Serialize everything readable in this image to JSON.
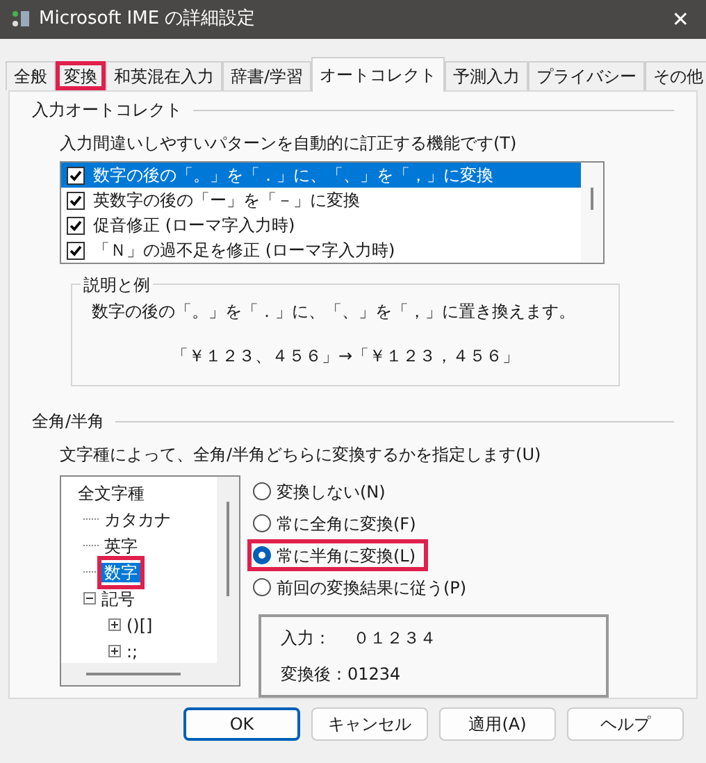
{
  "window": {
    "title": "Microsoft IME の詳細設定",
    "close": "✕"
  },
  "tabs": [
    {
      "label": "全般",
      "selected": false,
      "highlighted": false
    },
    {
      "label": "変換",
      "selected": false,
      "highlighted": true
    },
    {
      "label": "和英混在入力",
      "selected": false,
      "highlighted": false
    },
    {
      "label": "辞書/学習",
      "selected": false,
      "highlighted": false
    },
    {
      "label": "オートコレクト",
      "selected": true,
      "highlighted": false
    },
    {
      "label": "予測入力",
      "selected": false,
      "highlighted": false
    },
    {
      "label": "プライバシー",
      "selected": false,
      "highlighted": false
    },
    {
      "label": "その他",
      "selected": false,
      "highlighted": false
    }
  ],
  "autocorrect": {
    "title": "入力オートコレクト",
    "label": "入力間違いしやすいパターンを自動的に訂正する機能です(T)",
    "items": [
      {
        "label": "数字の後の「。」を「．」に、「、」を「，」に変換",
        "checked": true,
        "selected": true
      },
      {
        "label": "英数字の後の「ー」を「－」に変換",
        "checked": true,
        "selected": false
      },
      {
        "label": "促音修正 (ローマ字入力時)",
        "checked": true,
        "selected": false
      },
      {
        "label": "「Ｎ」の過不足を修正 (ローマ字入力時)",
        "checked": true,
        "selected": false
      }
    ],
    "example": {
      "title": "説明と例",
      "description": "数字の後の「。」を「．」に、「、」を「，」に置き換えます。",
      "sample": "「￥１２３、４５６」→「￥１２３，４５６」"
    }
  },
  "width": {
    "title": "全角/半角",
    "label": "文字種によって、全角/半角どちらに変換するかを指定します(U)",
    "tree": [
      {
        "label": "全文字種",
        "selected": false,
        "highlighted": false,
        "children": [
          {
            "label": "カタカナ",
            "selected": false,
            "highlighted": false
          },
          {
            "label": "英字",
            "selected": false,
            "highlighted": false
          },
          {
            "label": "数字",
            "selected": true,
            "highlighted": true
          },
          {
            "label": "記号",
            "selected": false,
            "highlighted": false,
            "expanded": true,
            "children": [
              {
                "label": "()[]",
                "selected": false,
                "highlighted": false,
                "expanded": false
              },
              {
                "label": ":;",
                "selected": false,
                "highlighted": false,
                "expanded": false
              }
            ]
          }
        ]
      }
    ],
    "options": [
      {
        "label": "変換しない(N)",
        "selected": false,
        "highlighted": false
      },
      {
        "label": "常に全角に変換(F)",
        "selected": false,
        "highlighted": false
      },
      {
        "label": "常に半角に変換(L)",
        "selected": true,
        "highlighted": true
      },
      {
        "label": "前回の変換結果に従う(P)",
        "selected": false,
        "highlighted": false
      }
    ],
    "preview": {
      "input_label": "入力：",
      "input_value": "０１２３４",
      "output_label": "変換後：",
      "output_value": "01234"
    }
  },
  "buttons": [
    {
      "label": "OK",
      "default": true
    },
    {
      "label": "キャンセル",
      "default": false
    },
    {
      "label": "適用(A)",
      "default": false
    },
    {
      "label": "ヘルプ",
      "default": false
    }
  ]
}
